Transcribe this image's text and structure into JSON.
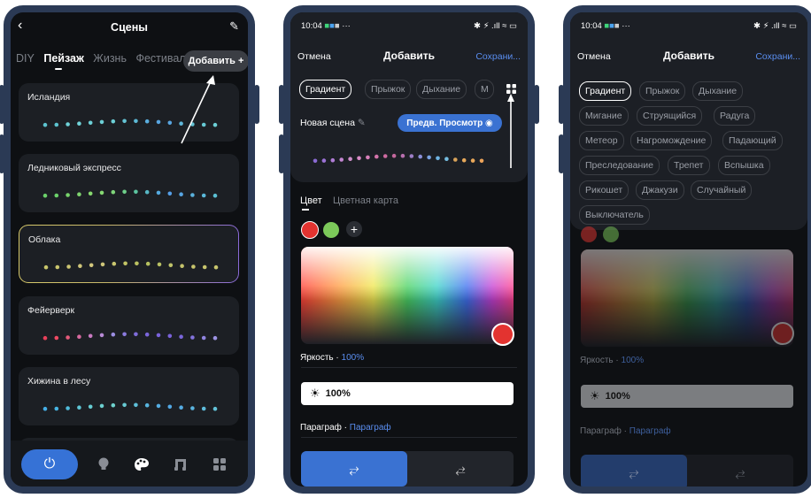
{
  "phone1": {
    "title": "Сцены",
    "tabs": [
      "DIY",
      "Пейзаж",
      "Жизнь",
      "Фестивал"
    ],
    "add_label": "Добавить +",
    "scenes": [
      {
        "name": "Исландия",
        "dots": [
          "#5cc3cf",
          "#5cc3cf",
          "#6fd2d8",
          "#71d3d9",
          "#6ccfd6",
          "#6ccfd6",
          "#6ccfd6",
          "#64c3d4",
          "#5db9d6",
          "#5aaede",
          "#58a5e0",
          "#58a5e0",
          "#5fb6d9",
          "#62c2d4",
          "#66c9d4",
          "#6ccfd6"
        ]
      },
      {
        "name": "Ледниковый экспресс",
        "dots": [
          "#6bd16a",
          "#6bd16a",
          "#78d56c",
          "#7fd46f",
          "#87d86f",
          "#86d973",
          "#7fd57a",
          "#6ecf8a",
          "#5cc4a0",
          "#57b7c4",
          "#55aae0",
          "#559fe8",
          "#57a5e3",
          "#5ab1dc",
          "#5ab8d9",
          "#5abfd3"
        ]
      },
      {
        "name": "Облака",
        "dots": [
          "#c8c56b",
          "#c9c56d",
          "#ccc573",
          "#d0c67a",
          "#d2c77d",
          "#cfc67a",
          "#c9c66f",
          "#c2c465",
          "#bcc262",
          "#b6c160",
          "#b9c164",
          "#bfc36a",
          "#c4c36c",
          "#c8c56d",
          "#c8c56d",
          "#c8c56d"
        ]
      },
      {
        "name": "Фейерверк",
        "dots": [
          "#e8405a",
          "#ee4a63",
          "#e55a7a",
          "#d86aa0",
          "#c97ac2",
          "#b98bd7",
          "#9b8ee2",
          "#8b7bde",
          "#7f6ddb",
          "#7b66db",
          "#7a62db",
          "#7a62da",
          "#7a66db",
          "#8474dd",
          "#9084e0",
          "#9c92e3"
        ]
      },
      {
        "name": "Хижина в лесу",
        "dots": [
          "#45aee6",
          "#47b4e2",
          "#50bcdc",
          "#5ec6d6",
          "#66cdd3",
          "#6cd0d0",
          "#6fd2cd",
          "#67cad3",
          "#5ebfd9",
          "#58b5df",
          "#55ade3",
          "#52a8e5",
          "#55ace3",
          "#5ab4df",
          "#5ebcdc",
          "#62c2d8"
        ]
      }
    ],
    "nav_icons": [
      "power-icon",
      "bulb-icon",
      "palette-icon",
      "music-icon",
      "grid-icon"
    ]
  },
  "phone2": {
    "time": "10:04",
    "status_right": "✱ ⚡ .ıll ≈ ▭",
    "cancel": "Отмена",
    "title": "Добавить",
    "save": "Сохрани...",
    "chips": [
      "Градиент",
      "Прыжок",
      "Дыхание",
      "М"
    ],
    "scene_name": "Новая сцена",
    "preview": "Предв. Просмотр",
    "preview_dots": [
      "#8a6ad3",
      "#9c72d6",
      "#b07cd6",
      "#c486d2",
      "#d08fcc",
      "#d88ac6",
      "#d77fb9",
      "#d374aa",
      "#cd6aa0",
      "#c3679c",
      "#b76fae",
      "#9d7ec7",
      "#8b8fd9",
      "#7aa3e2",
      "#6fb4e3",
      "#75bde0",
      "#d9a35a",
      "#e6a85a",
      "#eaa85a",
      "#eca35a"
    ],
    "color_tab": "Цвет",
    "colormap_tab": "Цветная карта",
    "brightness_label": "Яркость",
    "brightness_value": "100%",
    "brightness_bar": "100%",
    "paragraph_label": "Параграф",
    "paragraph_value": "Параграф"
  },
  "phone3": {
    "time": "10:04",
    "status_right": "✱ ⚡ .ıll ≈ ▭",
    "cancel": "Отмена",
    "title": "Добавить",
    "save": "Сохрани...",
    "effects": [
      "Градиент",
      "Прыжок",
      "Дыхание",
      "Мигание",
      "Струящийся",
      "Радуга",
      "Метеор",
      "Нагромождение",
      "Падающий",
      "Преследование",
      "Трепет",
      "Вспышка",
      "Рикошет",
      "Джакузи",
      "Случайный",
      "Выключатель"
    ],
    "brightness_label": "Яркость",
    "brightness_value": "100%",
    "brightness_bar": "100%",
    "paragraph_label": "Параграф",
    "paragraph_value": "Параграф"
  }
}
